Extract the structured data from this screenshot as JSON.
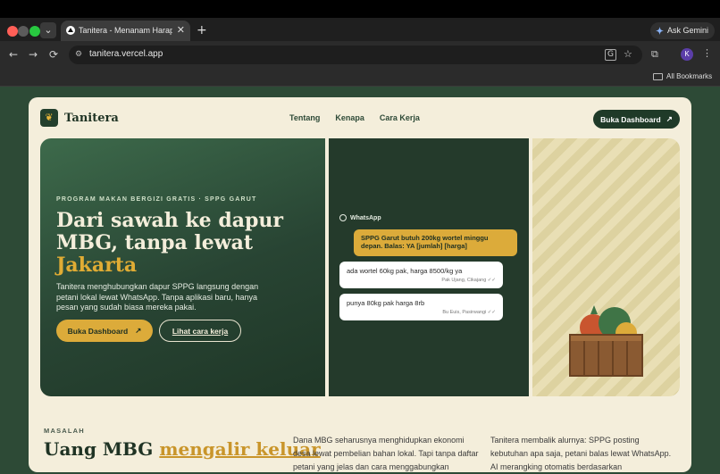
{
  "browser": {
    "tab_title": "Tanitera - Menanam Harapan",
    "tab_close": "✕",
    "new_tab": "+",
    "tab_list": "⌄",
    "gemini_label": "Ask Gemini",
    "url": "tanitera.vercel.app",
    "back": "←",
    "forward": "→",
    "reload": "⟳",
    "star": "☆",
    "translate": "G",
    "extensions": "⧉",
    "profile_initial": "K",
    "menu": "⋮",
    "bookmarks_label": "All Bookmarks"
  },
  "site": {
    "brand": "Tanitera",
    "brand_logo": "❦",
    "nav": [
      "Tentang",
      "Kenapa",
      "Cara Kerja"
    ],
    "cta_label": "Buka Dashboard",
    "cta_arrow": "↗"
  },
  "hero": {
    "eyebrow": "PROGRAM MAKAN BERGIZI GRATIS · SPPG GARUT",
    "headline_line1": "Dari sawah ke dapur",
    "headline_line2": "MBG, tanpa lewat",
    "headline_accent": "Jakarta",
    "subtext": "Tanitera menghubungkan dapur SPPG langsung dengan petani lokal lewat WhatsApp. Tanpa aplikasi baru, hanya pesan yang sudah biasa mereka pakai.",
    "primary_label": "Buka Dashboard",
    "primary_arrow": "↗",
    "secondary_label": "Lihat cara kerja"
  },
  "chat": {
    "label": "WhatsApp",
    "outgoing": "SPPG Garut butuh 200kg wortel minggu depan. Balas: YA [jumlah] [harga]",
    "replies": [
      {
        "text": "ada wortel 60kg pak, harga 8500/kg ya",
        "meta": "Pak Ujang, Cikajang ✓✓"
      },
      {
        "text": "punya 80kg pak harga 8rb",
        "meta": "Bu Euis, Pasirwangi ✓✓"
      }
    ]
  },
  "problem": {
    "eyebrow": "MASALAH",
    "title_plain": "Uang MBG ",
    "title_accent": "mengalir keluar",
    "col1": "Dana MBG seharusnya menghidupkan ekonomi desa lewat pembelian bahan lokal. Tapi tanpa daftar petani yang jelas dan cara menggabungkan",
    "col2": "Tanitera membalik alurnya: SPPG posting kebutuhan apa saja, petani balas lewat WhatsApp. AI merangking otomatis berdasarkan"
  },
  "colors": {
    "forest": "#2d4a36",
    "cream": "#f4eedb",
    "gold": "#dcab3a",
    "dark_green": "#1f3a28"
  }
}
